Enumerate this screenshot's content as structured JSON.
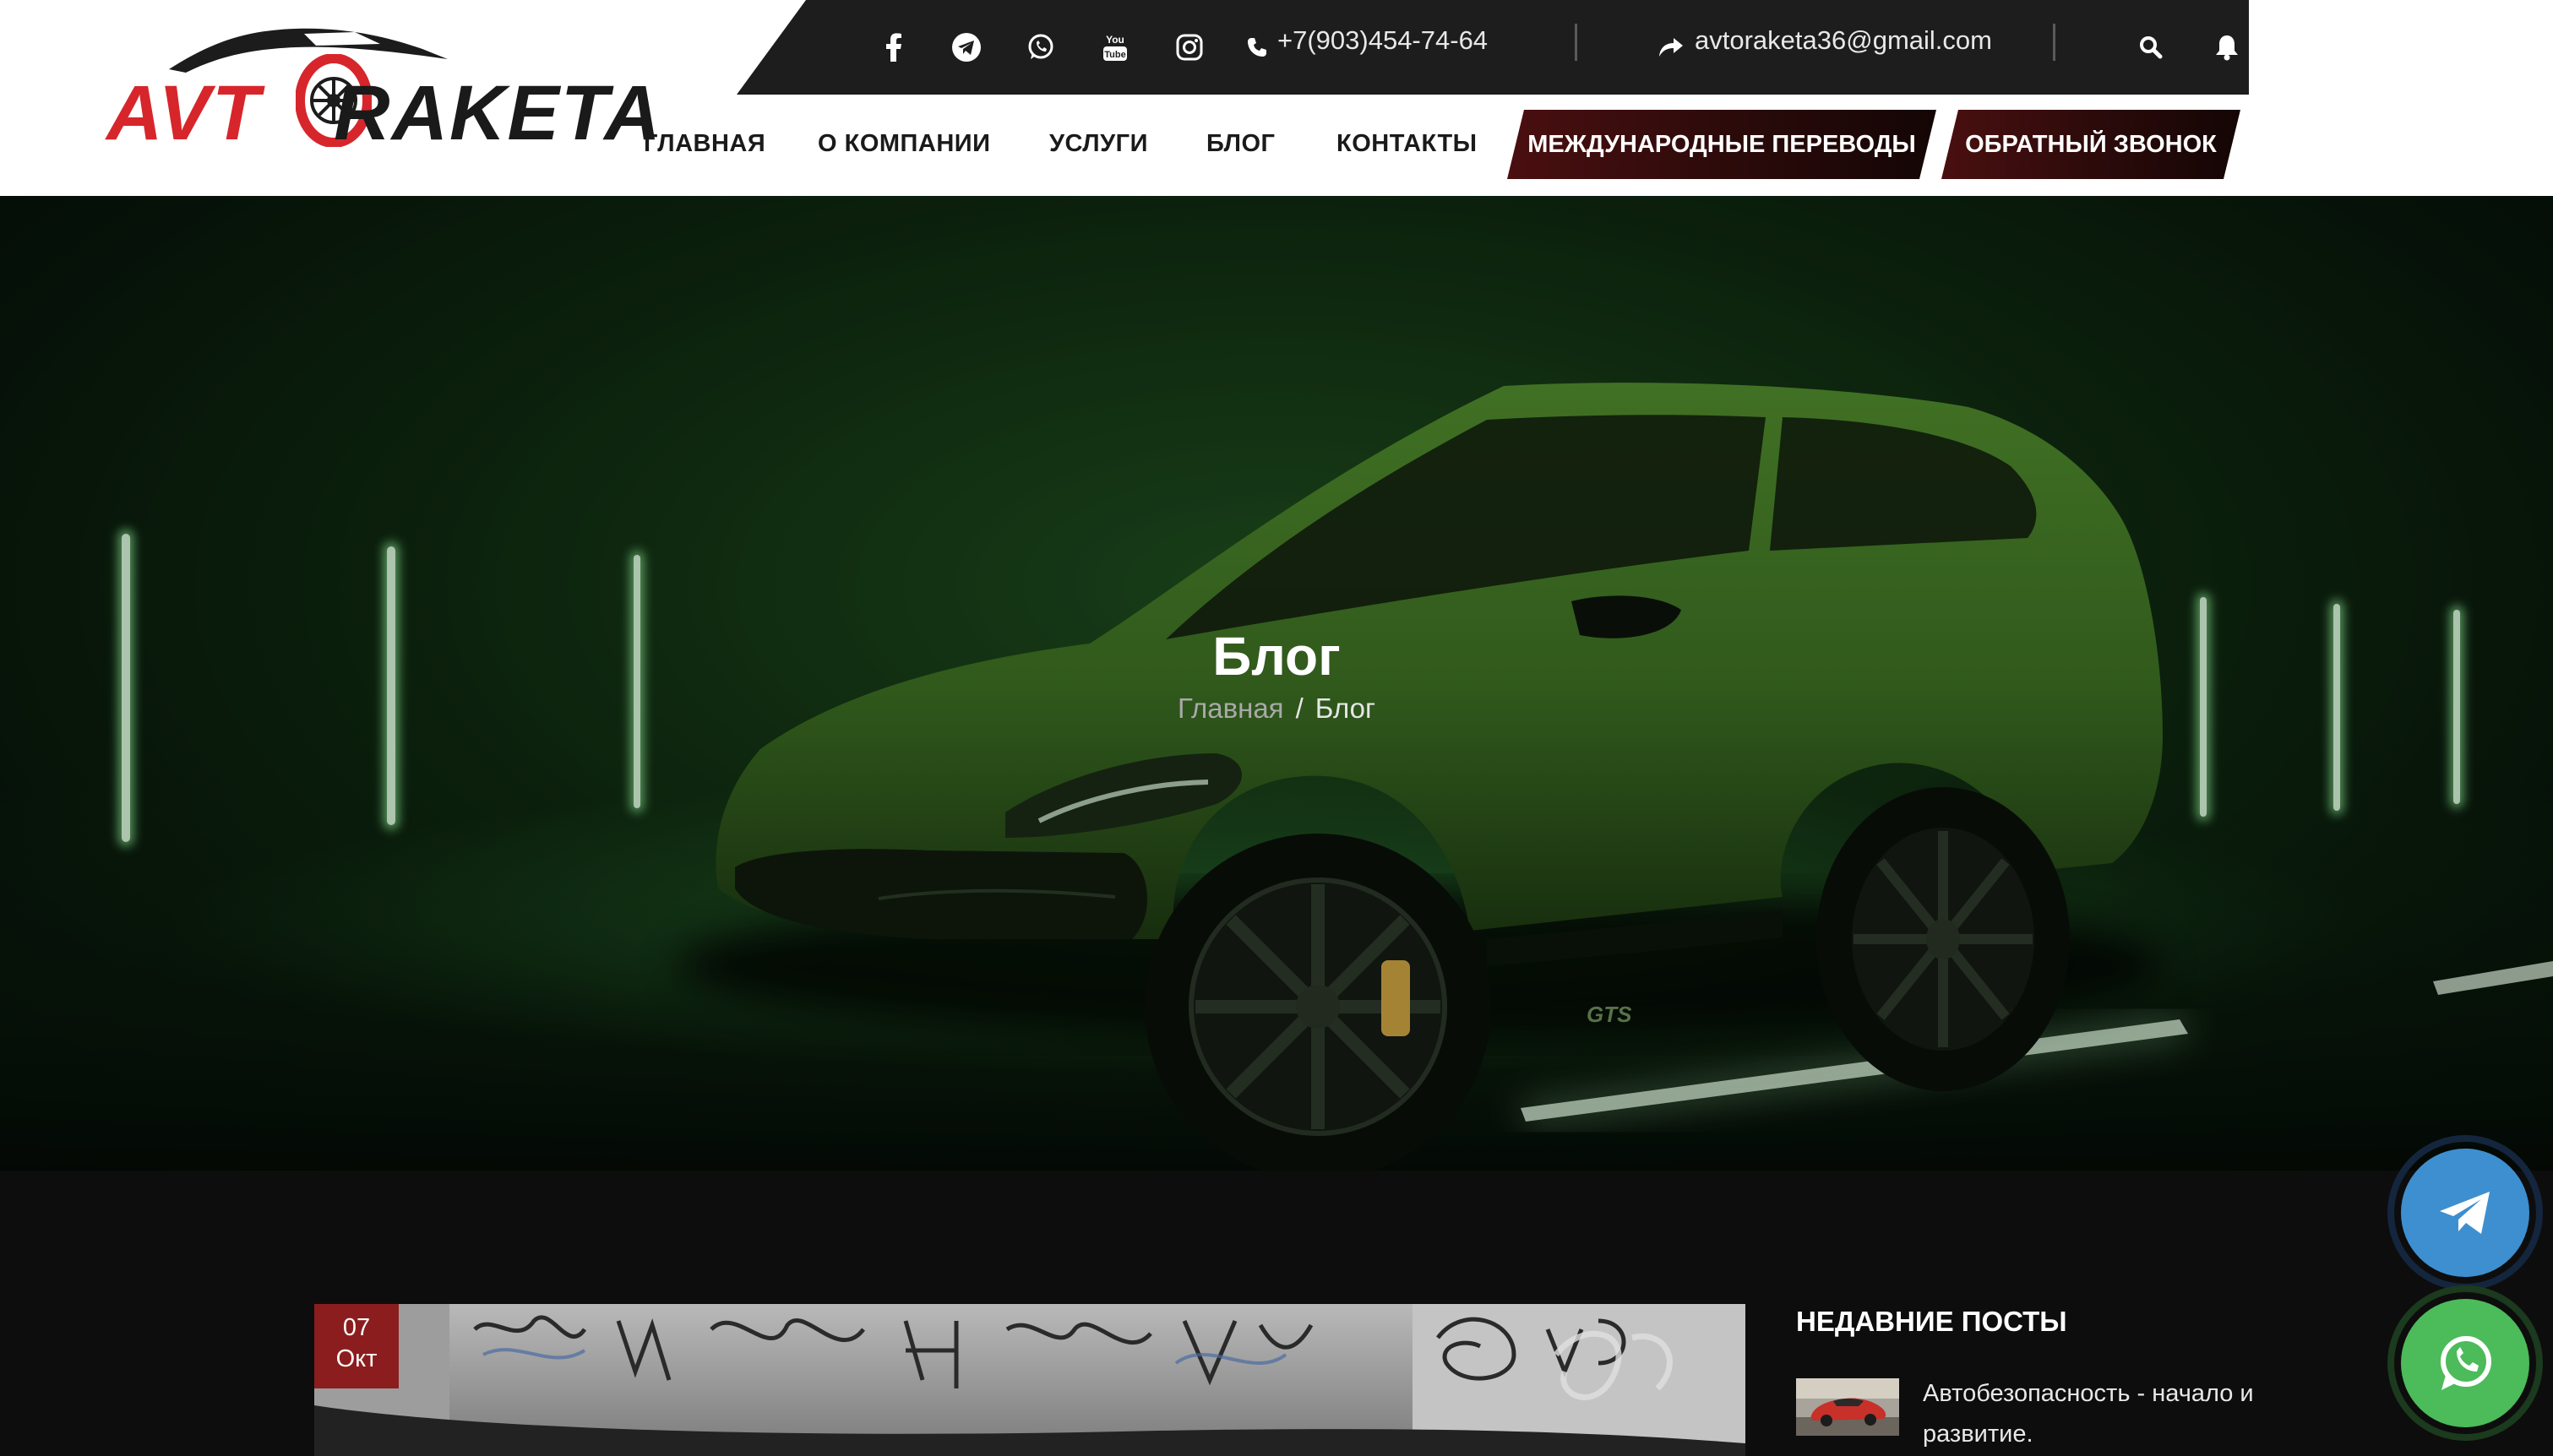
{
  "brand": {
    "logo_part1": "AVT",
    "logo_part2": "RAKETA",
    "red": "#d7262b",
    "dark_red": "#8b1d1e"
  },
  "topbar": {
    "phone": "+7(903)454-74-64",
    "email": "avtoraketa36@gmail.com",
    "social_icons": [
      "facebook-icon",
      "telegram-icon",
      "whatsapp-icon",
      "youtube-icon",
      "instagram-icon"
    ],
    "youtube_label": "You Tube"
  },
  "nav": {
    "items": [
      "ГЛАВНАЯ",
      "О КОМПАНИИ",
      "УСЛУГИ",
      "БЛОГ",
      "КОНТАКТЫ"
    ],
    "button_international": "МЕЖДУНАРОДНЫЕ ПЕРЕВОДЫ",
    "button_callback": "ОБРАТНЫЙ ЗВОНОК"
  },
  "hero": {
    "title": "Блог",
    "breadcrumb_home": "Главная",
    "breadcrumb_separator": "/",
    "breadcrumb_current": "Блог",
    "car_badge": "GTS"
  },
  "post": {
    "day": "07",
    "month": "Окт"
  },
  "sidebar": {
    "recent_title": "НЕДАВНИЕ ПОСТЫ",
    "recent_posts": [
      {
        "title": "Автобезопасность - начало и развитие."
      }
    ]
  },
  "floating": {
    "telegram_color": "#3d8fd0",
    "whatsapp_color": "#4cbb5a"
  }
}
